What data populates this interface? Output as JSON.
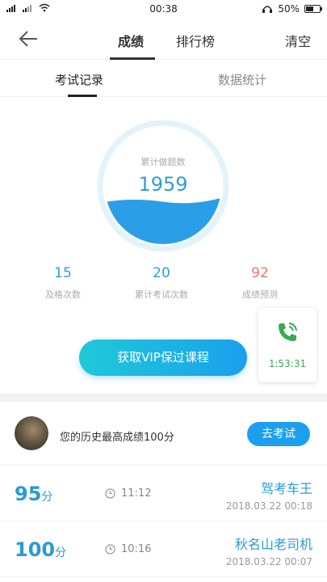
{
  "status": {
    "time": "00:38",
    "battery": "50%"
  },
  "nav": {
    "tab_score": "成绩",
    "tab_rank": "排行榜",
    "clear": "清空"
  },
  "subtabs": {
    "records": "考试记录",
    "stats": "数据统计"
  },
  "gauge": {
    "title": "累计做题数",
    "value": "1959",
    "fill_level": 0.35
  },
  "stats": [
    {
      "num": "15",
      "label": "及格次数"
    },
    {
      "num": "20",
      "label": "累计考试次数"
    },
    {
      "num": "92",
      "label": "成绩预测"
    }
  ],
  "vip_button": "获取VIP保过课程",
  "call": {
    "timer": "1:53:31"
  },
  "history": {
    "best_text": "您的历史最高成绩100分",
    "exam_button": "去考试"
  },
  "records": [
    {
      "score": "95",
      "unit": "分",
      "duration": "11:12",
      "title": "驾考车王",
      "date": "2018.03.22  00:18"
    },
    {
      "score": "100",
      "unit": "分",
      "duration": "10:16",
      "title": "秋名山老司机",
      "date": "2018.03.22  00:07"
    }
  ],
  "colors": {
    "accent": "#2f9fd6",
    "prediction": "#e8786a",
    "call_green": "#3aaa55"
  }
}
